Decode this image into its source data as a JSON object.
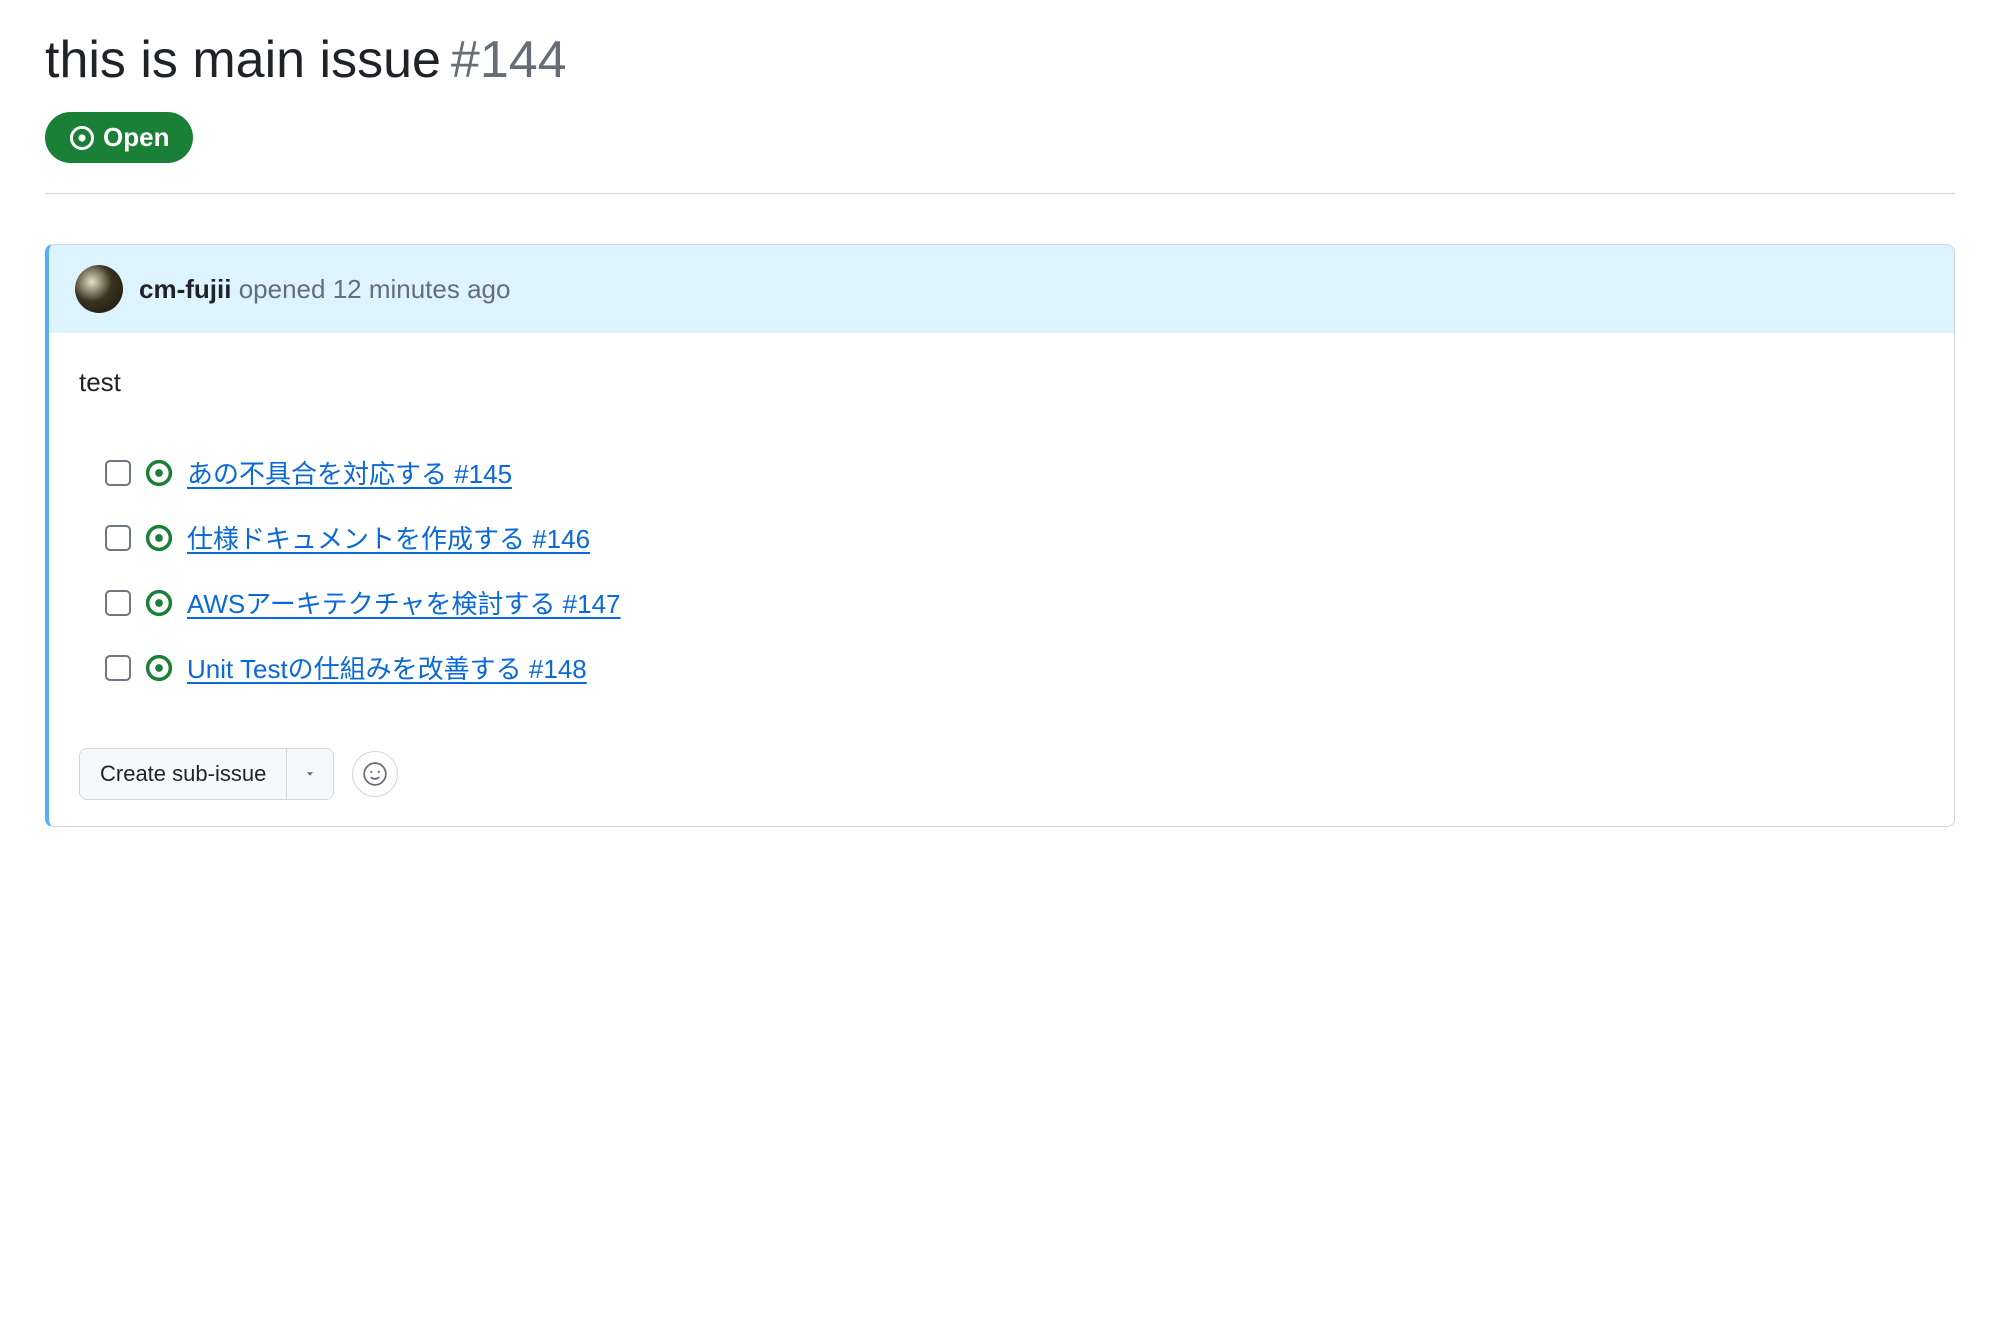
{
  "issue": {
    "title": "this is main issue",
    "number": "#144",
    "status_label": "Open"
  },
  "comment": {
    "author": "cm-fujii",
    "action": "opened",
    "time": "12 minutes ago",
    "body": "test"
  },
  "tasks": [
    {
      "title": "あの不具合を対応する",
      "ref": "#145"
    },
    {
      "title": "仕様ドキュメントを作成する",
      "ref": "#146"
    },
    {
      "title": "AWSアーキテクチャを検討する",
      "ref": "#147"
    },
    {
      "title": "Unit Testの仕組みを改善する",
      "ref": "#148"
    }
  ],
  "actions": {
    "create_sub_issue": "Create sub-issue"
  }
}
